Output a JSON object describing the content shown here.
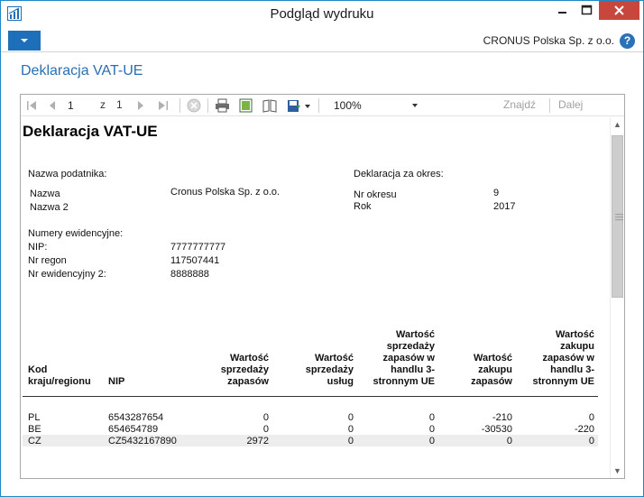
{
  "window": {
    "title": "Podgląd wydruku"
  },
  "ribbon": {
    "company": "CRONUS Polska Sp. z o.o.",
    "help_label": "?"
  },
  "page_title": "Deklaracja VAT-UE",
  "toolbar": {
    "current_page": "1",
    "of_label": "z",
    "total_pages": "1",
    "zoom": "100%",
    "find_label": "Znajdź",
    "next_label": "Dalej"
  },
  "report": {
    "title": "Deklaracja VAT-UE",
    "taxpayer_heading": "Nazwa podatnika:",
    "name_label": "Nazwa",
    "name_value": "Cronus Polska Sp. z o.o.",
    "name2_label": "Nazwa 2",
    "period_heading": "Deklaracja za okres:",
    "period_no_label": "Nr okresu",
    "period_no_value": "9",
    "year_label": "Rok",
    "year_value": "2017",
    "reg_heading": "Numery ewidencyjne:",
    "nip_label": "NIP:",
    "nip_value": "7777777777",
    "regon_label": "Nr regon",
    "regon_value": "117507441",
    "reg2_label": "Nr ewidencyjny 2:",
    "reg2_value": "8888888"
  },
  "table": {
    "columns": [
      [
        "Kod",
        "kraju/regionu"
      ],
      [
        "NIP"
      ],
      [
        "Wartość",
        "sprzedaży",
        "zapasów"
      ],
      [
        "Wartość",
        "sprzedaży",
        "usług"
      ],
      [
        "Wartość",
        "sprzedaży",
        "zapasów w",
        "handlu 3-",
        "stronnym UE"
      ],
      [
        "Wartość",
        "zakupu",
        "zapasów"
      ],
      [
        "Wartość",
        "zakupu",
        "zapasów w",
        "handlu 3-",
        "stronnym UE"
      ]
    ],
    "rows": [
      [
        "PL",
        "6543287654",
        "0",
        "0",
        "0",
        "-210",
        "0"
      ],
      [
        "BE",
        "654654789",
        "0",
        "0",
        "0",
        "-30530",
        "-220"
      ],
      [
        "CZ",
        "CZ5432167890",
        "2972",
        "0",
        "0",
        "0",
        "0"
      ]
    ]
  }
}
